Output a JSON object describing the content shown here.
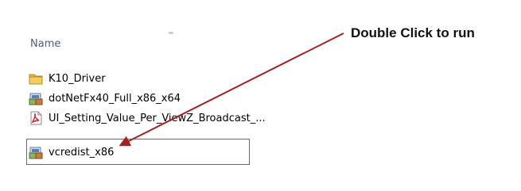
{
  "explorer": {
    "column_header": "Name",
    "files": [
      {
        "name": "K10_Driver",
        "icon": "folder-icon"
      },
      {
        "name": "dotNetFx40_Full_x86_x64",
        "icon": "installer-icon"
      },
      {
        "name": "UI_Setting_Value_Per_ViewZ_Broadcast_...",
        "icon": "pdf-icon"
      },
      {
        "name": "vcredist_x86",
        "icon": "installer-icon"
      }
    ]
  },
  "annotation": {
    "text": "Double Click to run",
    "color": "#111111",
    "arrow_color": "#a51f1f",
    "box_color": "#d33a3a"
  }
}
